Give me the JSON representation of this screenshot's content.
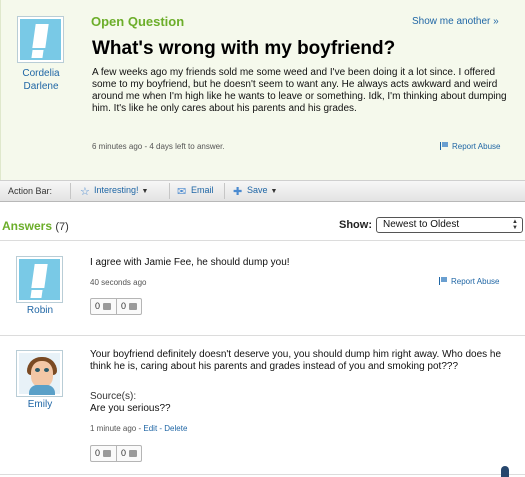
{
  "question": {
    "header_label": "Open Question",
    "show_another": "Show me another »",
    "asker": "Cordelia Darlene",
    "title": "What's wrong with my boyfriend?",
    "body": "A few weeks ago my friends sold me some weed and I've been doing it a lot since. I offered some to my boyfriend, but he doesn't seem to want any. He always acts awkward and weird around me when I'm high like he wants to leave or something. Idk, I'm thinking about dumping him. It's like he only cares about his parents and his grades.",
    "meta": "6 minutes ago - 4 days left to answer.",
    "report": "Report Abuse"
  },
  "action_bar": {
    "label": "Action Bar:",
    "interesting": "Interesting!",
    "email": "Email",
    "save": "Save"
  },
  "answers": {
    "title": "Answers",
    "count": "(7)",
    "show_label": "Show:",
    "sort_value": "Newest to Oldest",
    "items": [
      {
        "user": "Robin",
        "text": "I agree with Jamie Fee, he should dump you!",
        "meta": "40 seconds ago",
        "report": "Report Abuse",
        "thumbs_up": "0",
        "thumbs_down": "0"
      },
      {
        "user": "Emily",
        "text": "Your boyfriend definitely doesn't deserve you, you should dump him right away. Who does he think he is, caring about his parents and grades instead of you and smoking pot???",
        "source_label": "Source(s):",
        "source": "Are you serious??",
        "meta": "1 minute ago - ",
        "edit": "Edit",
        "dash": " - ",
        "delete": "Delete",
        "thumbs_up": "0",
        "thumbs_down": "0"
      }
    ]
  },
  "colors": {
    "accent_green": "#6cae2a",
    "link_blue": "#1f66a5",
    "panel_bg": "#f5f9ec",
    "avatar_blue": "#79c9e6"
  }
}
